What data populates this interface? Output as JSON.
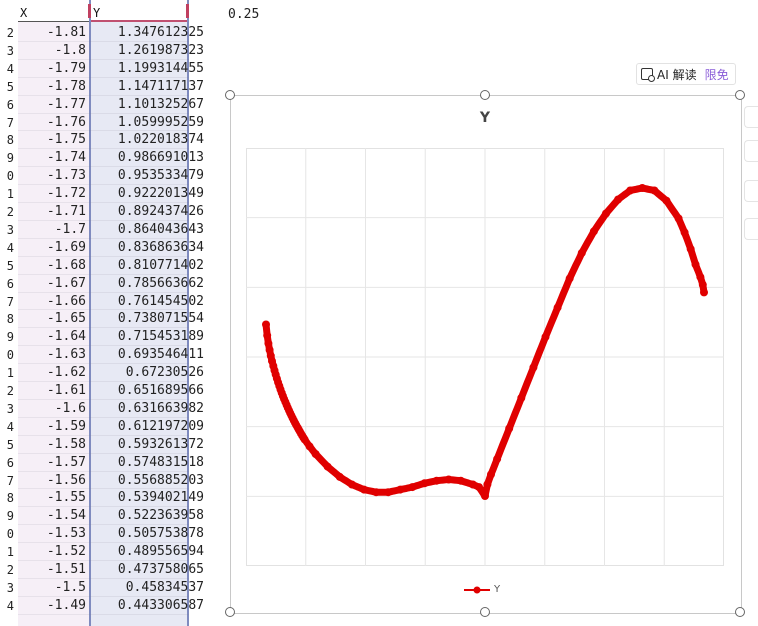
{
  "sheet": {
    "col_headers": {
      "x": "X",
      "y": "Y"
    },
    "corner_value": "0.25",
    "row_numbers": [
      "2",
      "3",
      "4",
      "5",
      "6",
      "7",
      "8",
      "9",
      "0",
      "1",
      "2",
      "3",
      "4",
      "5",
      "6",
      "7",
      "8",
      "9",
      "0",
      "1",
      "2",
      "3",
      "4",
      "5",
      "6",
      "7",
      "8",
      "9",
      "0",
      "1",
      "2",
      "3",
      "4"
    ],
    "rows": [
      {
        "x": "-1.81",
        "y": "1.347612325"
      },
      {
        "x": "-1.8",
        "y": "1.261987323"
      },
      {
        "x": "-1.79",
        "y": "1.199314455"
      },
      {
        "x": "-1.78",
        "y": "1.147117137"
      },
      {
        "x": "-1.77",
        "y": "1.101325267"
      },
      {
        "x": "-1.76",
        "y": "1.059995259"
      },
      {
        "x": "-1.75",
        "y": "1.022018374"
      },
      {
        "x": "-1.74",
        "y": "0.986691013"
      },
      {
        "x": "-1.73",
        "y": "0.953533479"
      },
      {
        "x": "-1.72",
        "y": "0.922201349"
      },
      {
        "x": "-1.71",
        "y": "0.892437426"
      },
      {
        "x": "-1.7",
        "y": "0.864043643"
      },
      {
        "x": "-1.69",
        "y": "0.836863634"
      },
      {
        "x": "-1.68",
        "y": "0.810771402"
      },
      {
        "x": "-1.67",
        "y": "0.785663662"
      },
      {
        "x": "-1.66",
        "y": "0.761454502"
      },
      {
        "x": "-1.65",
        "y": "0.738071554"
      },
      {
        "x": "-1.64",
        "y": "0.715453189"
      },
      {
        "x": "-1.63",
        "y": "0.693546411"
      },
      {
        "x": "-1.62",
        "y": "0.67230526"
      },
      {
        "x": "-1.61",
        "y": "0.651689566"
      },
      {
        "x": "-1.6",
        "y": "0.631663982"
      },
      {
        "x": "-1.59",
        "y": "0.612197209"
      },
      {
        "x": "-1.58",
        "y": "0.593261372"
      },
      {
        "x": "-1.57",
        "y": "0.574831518"
      },
      {
        "x": "-1.56",
        "y": "0.556885203"
      },
      {
        "x": "-1.55",
        "y": "0.539402149"
      },
      {
        "x": "-1.54",
        "y": "0.522363958"
      },
      {
        "x": "-1.53",
        "y": "0.505753878"
      },
      {
        "x": "-1.52",
        "y": "0.489556594"
      },
      {
        "x": "-1.51",
        "y": "0.473758065"
      },
      {
        "x": "-1.5",
        "y": "0.45834537"
      },
      {
        "x": "-1.49",
        "y": "0.443306587"
      }
    ]
  },
  "ai_badge": {
    "label": "AI 解读",
    "tag": "限免",
    "icon": "ai-read-icon"
  },
  "colors": {
    "series": "#e00000",
    "grid": "#e6e6e6",
    "accent": "#8a5cd8"
  },
  "chart_data": {
    "type": "scatter",
    "title": "Y",
    "legend": [
      "Y"
    ],
    "legend_position": "bottom",
    "grid": true,
    "xlim": [
      -1.81,
      1.81
    ],
    "series": [
      {
        "name": "Y",
        "x": [
          -1.81,
          -1.8,
          -1.79,
          -1.78,
          -1.77,
          -1.76,
          -1.75,
          -1.74,
          -1.73,
          -1.72,
          -1.71,
          -1.7,
          -1.69,
          -1.68,
          -1.67,
          -1.66,
          -1.65,
          -1.64,
          -1.63,
          -1.62,
          -1.61,
          -1.6,
          -1.59,
          -1.58,
          -1.57,
          -1.56,
          -1.55,
          -1.54,
          -1.53,
          -1.52,
          -1.51,
          -1.5,
          -1.49,
          -1.45,
          -1.4,
          -1.3,
          -1.2,
          -1.1,
          -1.0,
          -0.9,
          -0.8,
          -0.7,
          -0.6,
          -0.5,
          -0.4,
          -0.3,
          -0.2,
          -0.1,
          -0.05,
          0.0,
          0.02,
          0.05,
          0.1,
          0.2,
          0.3,
          0.4,
          0.5,
          0.6,
          0.7,
          0.8,
          0.9,
          1.0,
          1.1,
          1.2,
          1.3,
          1.4,
          1.5,
          1.6,
          1.65,
          1.7,
          1.74,
          1.78,
          1.8,
          1.81
        ],
        "y": [
          1.347612325,
          1.261987323,
          1.199314455,
          1.147117137,
          1.101325267,
          1.059995259,
          1.022018374,
          0.986691013,
          0.953533479,
          0.922201349,
          0.892437426,
          0.864043643,
          0.836863634,
          0.810771402,
          0.785663662,
          0.761454502,
          0.738071554,
          0.715453189,
          0.693546411,
          0.67230526,
          0.651689566,
          0.631663982,
          0.612197209,
          0.593261372,
          0.574831518,
          0.556885203,
          0.539402149,
          0.522363958,
          0.505753878,
          0.489556594,
          0.473758065,
          0.45834537,
          0.443306587,
          0.39,
          0.33,
          0.23,
          0.15,
          0.09,
          0.05,
          0.03,
          0.03,
          0.05,
          0.07,
          0.1,
          0.12,
          0.13,
          0.12,
          0.09,
          0.07,
          0.0,
          0.09,
          0.17,
          0.29,
          0.53,
          0.77,
          1.01,
          1.25,
          1.48,
          1.71,
          1.91,
          2.08,
          2.22,
          2.33,
          2.4,
          2.42,
          2.4,
          2.32,
          2.18,
          2.07,
          1.94,
          1.82,
          1.72,
          1.66,
          1.6
        ]
      }
    ]
  }
}
